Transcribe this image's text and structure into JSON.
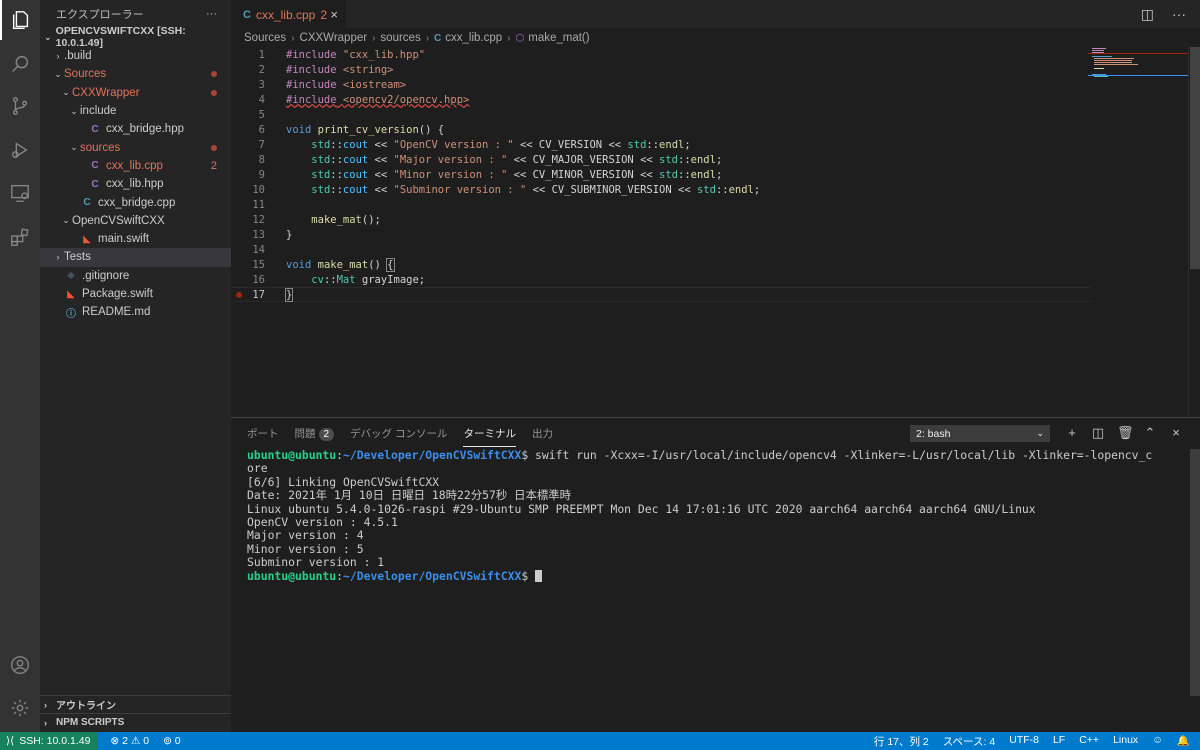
{
  "activity": {
    "icons": [
      "explorer-icon",
      "search-icon",
      "source-control-icon",
      "run-debug-icon",
      "remote-explorer-icon",
      "extensions-icon",
      "account-icon",
      "manage-icon"
    ]
  },
  "sidebar": {
    "title": "エクスプローラー",
    "more": "···",
    "root": "OPENCVSWIFTCXX [SSH: 10.0.1.49]",
    "tree": [
      {
        "label": ".build",
        "chev": "›",
        "indent": 12,
        "icon": ""
      },
      {
        "label": "Sources",
        "chev": "⌄",
        "indent": 12,
        "icon": "",
        "mod": true,
        "dot": true
      },
      {
        "label": "CXXWrapper",
        "chev": "⌄",
        "indent": 20,
        "icon": "",
        "mod": true,
        "dot": true
      },
      {
        "label": "include",
        "chev": "⌄",
        "indent": 28,
        "icon": ""
      },
      {
        "label": "cxx_bridge.hpp",
        "chev": "",
        "indent": 36,
        "icon": "C",
        "iconColor": "#a074c4"
      },
      {
        "label": "sources",
        "chev": "⌄",
        "indent": 28,
        "icon": "",
        "mod": true,
        "dot": true
      },
      {
        "label": "cxx_lib.cpp",
        "chev": "",
        "indent": 36,
        "icon": "C",
        "iconColor": "#a074c4",
        "mod": true,
        "count": "2"
      },
      {
        "label": "cxx_lib.hpp",
        "chev": "",
        "indent": 36,
        "icon": "C",
        "iconColor": "#a074c4"
      },
      {
        "label": "cxx_bridge.cpp",
        "chev": "",
        "indent": 28,
        "icon": "C",
        "iconColor": "#519aba"
      },
      {
        "label": "OpenCVSwiftCXX",
        "chev": "⌄",
        "indent": 20,
        "icon": ""
      },
      {
        "label": "main.swift",
        "chev": "",
        "indent": 28,
        "icon": "◣",
        "iconColor": "#f05138"
      },
      {
        "label": "Tests",
        "chev": "›",
        "indent": 12,
        "icon": "",
        "selected": true
      },
      {
        "label": ".gitignore",
        "chev": "",
        "indent": 12,
        "icon": "◆",
        "iconColor": "#41535b"
      },
      {
        "label": "Package.swift",
        "chev": "",
        "indent": 12,
        "icon": "◣",
        "iconColor": "#f05138"
      },
      {
        "label": "README.md",
        "chev": "",
        "indent": 12,
        "icon": "ⓘ",
        "iconColor": "#519aba"
      }
    ],
    "outline": "アウトライン",
    "npm": "NPM SCRIPTS"
  },
  "editor": {
    "tab": {
      "icon": "C",
      "name": "cxx_lib.cpp",
      "count": "2",
      "close": "×"
    },
    "actions": [
      "◫",
      "···"
    ],
    "breadcrumb": [
      "Sources",
      "CXXWrapper",
      "sources",
      "cxx_lib.cpp",
      "make_mat()"
    ],
    "current_line": 17,
    "breakpoint_line": 17
  },
  "panel": {
    "tabs": [
      {
        "label": "ポート"
      },
      {
        "label": "問題",
        "badge": "2"
      },
      {
        "label": "デバッグ コンソール"
      },
      {
        "label": "ターミナル",
        "active": true
      },
      {
        "label": "出力"
      }
    ],
    "terminal_select": "2: bash",
    "actions": [
      "+",
      "◫",
      "🗑",
      "⌃",
      "×"
    ],
    "terminal": {
      "user": "ubuntu@ubuntu",
      "path": "~/Developer/OpenCVSwiftCXX",
      "command": "$ swift run -Xcxx=-I/usr/local/include/opencv4 -Xlinker=-L/usr/local/lib -Xlinker=-lopencv_c",
      "wrap": "ore",
      "output": [
        "[6/6] Linking OpenCVSwiftCXX",
        "Date: 2021年 1月 10日 日曜日 18時22分57秒 日本標準時",
        "Linux ubuntu 5.4.0-1026-raspi #29-Ubuntu SMP PREEMPT Mon Dec 14 17:01:16 UTC 2020 aarch64 aarch64 aarch64 GNU/Linux",
        "OpenCV version : 4.5.1",
        "Major version : 4",
        "Minor version : 5",
        "Subminor version : 1"
      ],
      "prompt_end": "$ "
    }
  },
  "statusbar": {
    "remote": "SSH: 10.0.1.49",
    "errors": "⊗ 2 ⚠ 0",
    "ports": "⊚ 0",
    "position": "行 17、列 2",
    "spaces": "スペース: 4",
    "encoding": "UTF-8",
    "eol": "LF",
    "language": "C++",
    "os": "Linux"
  },
  "colors": {
    "accent": "#007acc",
    "remote": "#16825d",
    "modified": "#e2735b"
  }
}
